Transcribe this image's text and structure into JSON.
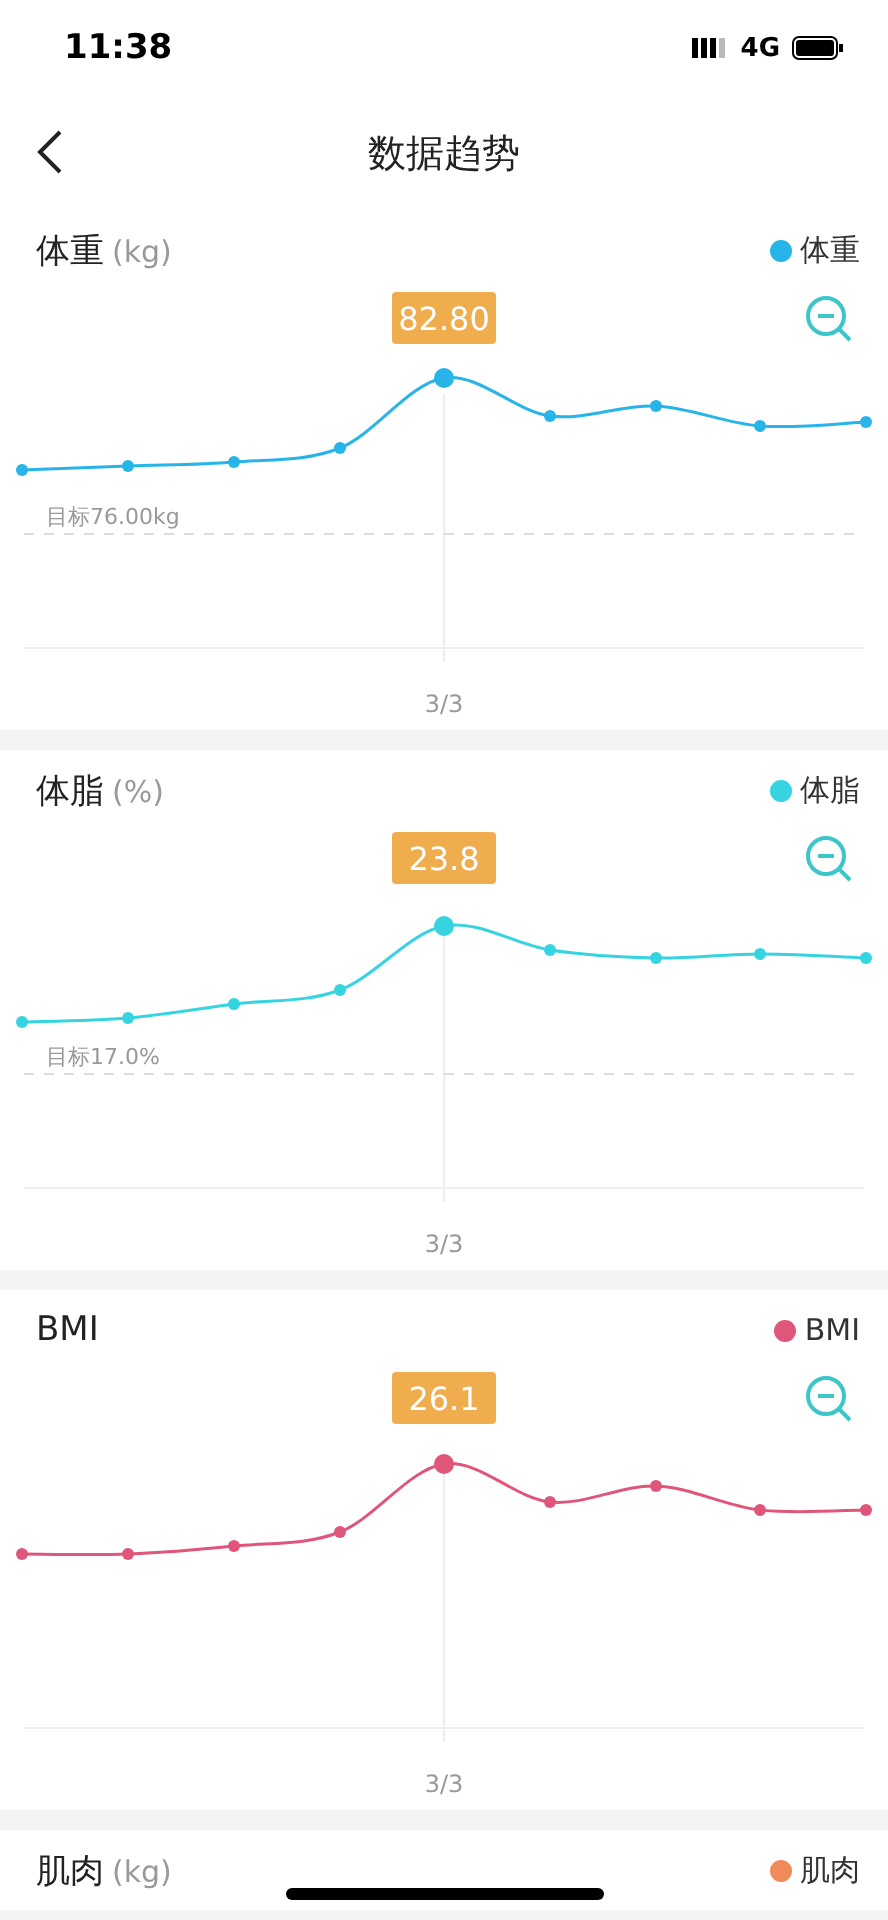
{
  "status_bar": {
    "time": "11:38",
    "network": "4G"
  },
  "header": {
    "title": "数据趋势"
  },
  "cards": [
    {
      "title": "体重",
      "unit": "(kg)",
      "legend": "体重",
      "color": "#27b4e8",
      "value": "82.80",
      "target": "目标76.00kg",
      "x_label": "3/3"
    },
    {
      "title": "体脂",
      "unit": "(%)",
      "legend": "体脂",
      "color": "#36d3e0",
      "value": "23.8",
      "target": "目标17.0%",
      "x_label": "3/3"
    },
    {
      "title": "BMI",
      "legend": "BMI",
      "color": "#e0557a",
      "value": "26.1",
      "x_label": "3/3"
    },
    {
      "title": "肌肉",
      "unit": "(kg)",
      "legend": "肌肉",
      "color": "#f08a5a"
    }
  ]
}
